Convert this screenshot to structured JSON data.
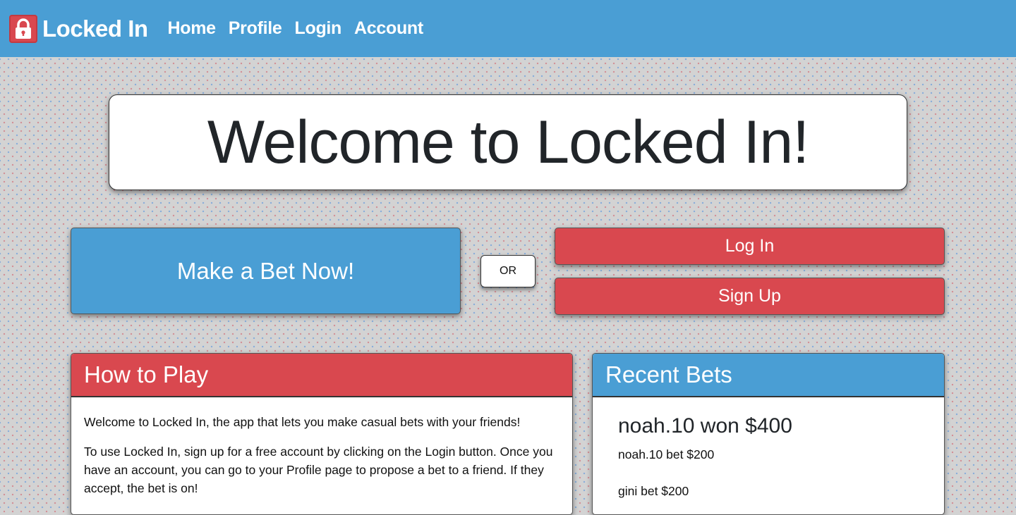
{
  "navbar": {
    "brand": "Locked In",
    "links": [
      "Home",
      "Profile",
      "Login",
      "Account"
    ]
  },
  "hero": {
    "title": "Welcome to Locked In!"
  },
  "actions": {
    "make_bet": "Make a Bet Now!",
    "or": "OR",
    "login": "Log In",
    "signup": "Sign Up"
  },
  "how_to_play": {
    "title": "How to Play",
    "paragraphs": [
      "Welcome to Locked In, the app that lets you make casual bets with your friends!",
      "To use Locked In, sign up for a free account by clicking on the Login button. Once you have an account, you can go to your Profile page to propose a bet to a friend. If they accept, the bet is on!"
    ]
  },
  "recent_bets": {
    "title": "Recent Bets",
    "items": [
      {
        "headline": "noah.10 won $400",
        "lines": [
          "noah.10 bet $200",
          "gini bet $200"
        ]
      }
    ]
  },
  "colors": {
    "blue": "#4a9ed4",
    "red": "#d9484f",
    "background": "#d3d3d3"
  },
  "icons": {
    "brand": "lock-icon"
  }
}
